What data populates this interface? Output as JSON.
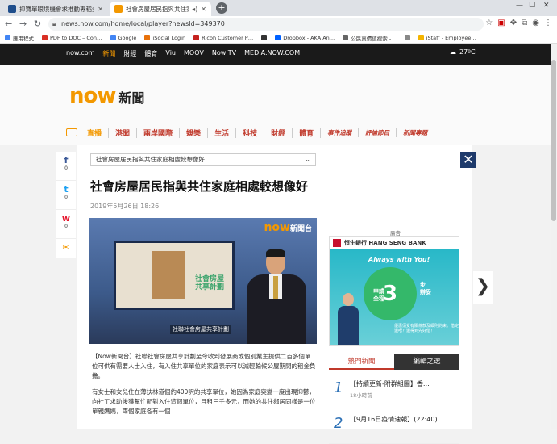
{
  "browser": {
    "tabs": [
      {
        "label": "抑寶單眼境機會求推動專稻金部",
        "active": false
      },
      {
        "label": "社會房屋居民指與共住家庭相",
        "active": true
      }
    ],
    "url": "news.now.com/home/local/player?newsId=349370",
    "bookmarks": [
      "應用程式",
      "PDF to DOC – Con…",
      "Google",
      "iSocial Login",
      "Ricoh Customer P…",
      "",
      "Dropbox - AKA An…",
      "公民真價值搜索 -…",
      "",
      "iStaff - Employee…"
    ],
    "bookmark_colors": [
      "#4285f4",
      "#d93025",
      "#4285f4",
      "#e8710a",
      "#c5221f",
      "#333333",
      "#0061ff",
      "#666666",
      "#888888",
      "#f4b400"
    ]
  },
  "site": {
    "top_links": [
      "now.com",
      "新聞",
      "財經",
      "體育",
      "Viu",
      "MOOV",
      "Now TV",
      "MEDIA.NOW.COM"
    ],
    "active_link": "新聞",
    "weather": "27ºC",
    "logo_now": "now",
    "logo_news": "新聞",
    "nav": [
      "直播",
      "港聞",
      "兩岸國際",
      "娛樂",
      "生活",
      "科技",
      "財經",
      "體育",
      "事件追蹤",
      "評論節目",
      "新聞專題"
    ],
    "nav_small": [
      "事件追蹤",
      "評論節目",
      "新聞專題"
    ]
  },
  "modal": {
    "dropdown_value": "社會房屋居民指與共住家庭相處較想像好",
    "close_label": "✕",
    "title": "社會房屋居民指與共住家庭相處較想像好",
    "date": "2019年5月26日 18:26",
    "video": {
      "brand": "now",
      "brand_sub": "新聞台",
      "logo_text_1": "社會房屋",
      "logo_text_2": "共享計劃",
      "caption": "社聯社會房屋共享計劃"
    },
    "paragraphs": [
      "【Now新聞台】社聯社會房屋共享計劃至今收到發展商或個別業主提供二百多個單位可供有需要人士入住，有入住共享單位的家庭表示可以減輕輪候公屋期間的租金負擔。",
      "有女士和女兒住在薄扶林道個約400呎的共享單位，她因為家庭突變一度出現抑鬱，向社工求助後獲幫忙配對入住這個單位，月租三千多元，而她的共住鄰居同樣是一位單親媽媽，兩個家庭各有一個"
    ],
    "ad_label": "廣告",
    "ad": {
      "bank": "恒生銀行 HANG SENG BANK",
      "tagline": "Always with You!",
      "big": "3",
      "side_1": "步",
      "side_2": "辦妥",
      "left_1": "申請",
      "left_2": "全程",
      "foot": "優惠須受有關條款及細則約束。借定還唔？還得到先好借！"
    },
    "news_tabs": [
      "熱門新聞",
      "編輯之選"
    ],
    "news": [
      {
        "num": "1",
        "title": "【持續更新-附群組圖】香…",
        "when": "18小時前"
      },
      {
        "num": "2",
        "title": "【9月16日疫情速報】(22:40)",
        "when": ""
      }
    ]
  },
  "share": [
    {
      "icon": "f",
      "count": "0",
      "color": "#3b5998"
    },
    {
      "icon": "t",
      "count": "0",
      "color": "#1da1f2"
    },
    {
      "icon": "w",
      "count": "0",
      "color": "#e6162d"
    },
    {
      "icon": "✉",
      "count": "",
      "color": "#f39800"
    }
  ],
  "next_label": "❯"
}
